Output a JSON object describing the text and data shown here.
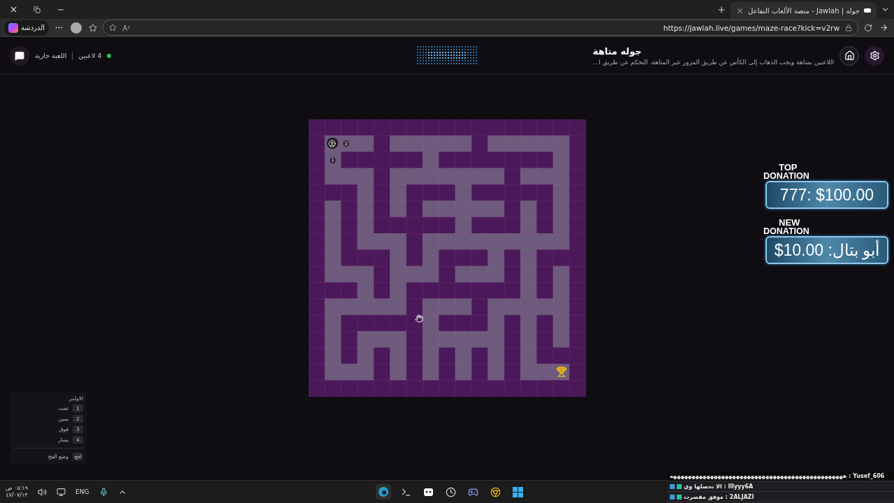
{
  "browser": {
    "tab_title": "جولة | Jawlah - منصة الألعاب التفاعل",
    "url": "https://jawlah.live/games/maze-race?kick=v2rw",
    "chat_button": "الدردشة"
  },
  "header": {
    "title": "جوله متاهة",
    "description": "اللاعبين بمتاهة ويجب الذهاب إلى الكأس عن طريق المرور عبر المتاهة، التحكم عن طريق ا...",
    "players": "4 لاعبين",
    "online": true,
    "state": "اللعبة جارية"
  },
  "maze": {
    "player_badges": [
      "2",
      "1"
    ]
  },
  "donations": [
    {
      "label_top": "TOP",
      "label_bottom": "DONATION",
      "value": "777: $100.00"
    },
    {
      "label_top": "NEW",
      "label_bottom": "DONATION",
      "value": "أبو بتال: 10.00$"
    }
  ],
  "commands": {
    "title": "الاوامر",
    "items": [
      {
        "key": "1",
        "label": "تحت"
      },
      {
        "key": "2",
        "label": "يمين"
      },
      {
        "key": "3",
        "label": "فوق"
      },
      {
        "key": "4",
        "label": "يسار"
      }
    ],
    "trap": {
      "key": "افخ",
      "label": "وضع الفخ"
    }
  },
  "chat": [
    {
      "line": "Yusef_606 : هههههههههههههههههههههههههههههههههههههههههههههههه",
      "highlight": true
    },
    {
      "line": "lllyyy6A : الا تحصلها وي",
      "highlight": false
    },
    {
      "line": "2ALJAZI : موفق مقصرت",
      "highlight": false
    }
  ],
  "taskbar": {
    "time": "٠٥:١٩ ص",
    "date": "٤٧/٠٧/١٣",
    "language": "ENG"
  }
}
